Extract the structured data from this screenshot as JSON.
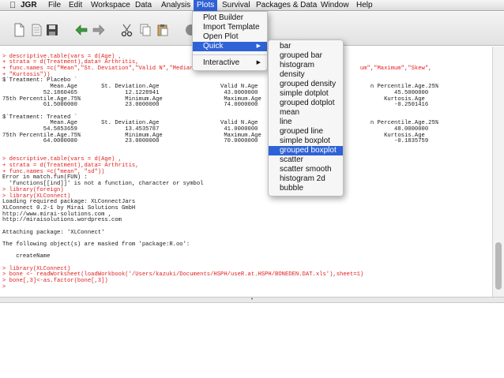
{
  "menubar": {
    "app": "JGR",
    "items": [
      "File",
      "Edit",
      "Workspace",
      "Data",
      "Analysis",
      "Plots",
      "Survival",
      "Packages & Data",
      "Window",
      "Help"
    ],
    "active": "Plots"
  },
  "plots_menu": {
    "items": [
      "Plot Builder",
      "Import Template",
      "Open Plot"
    ],
    "quick": "Quick",
    "interactive": "Interactive"
  },
  "quick_menu": {
    "items": [
      "bar",
      "grouped bar",
      "histogram",
      "density",
      "grouped density",
      "simple dotplot",
      "grouped dotplot",
      "mean",
      "line",
      "grouped line",
      "simple boxplot",
      "grouped boxplot",
      "scatter",
      "scatter smooth",
      "histogram 2d",
      "bubble"
    ],
    "highlighted": "grouped boxplot"
  },
  "console": {
    "lines": [
      {
        "t": "cmd",
        "s": ""
      },
      {
        "t": "cmd",
        "s": "> descriptive.table(vars = d(Age) ,"
      },
      {
        "t": "cmd",
        "s": "+ strata = d(Treatment),data= Arthritis,"
      },
      {
        "t": "cmd",
        "s": "+ func.names =c(\"Mean\",\"St. Deviation\",\"Valid N\",\"Median\",\"25th Percentile\",\"                            um\",\"Maximum\",\"Skew\","
      },
      {
        "t": "cmd",
        "s": "+ \"Kurtosis\"))"
      },
      {
        "t": "out",
        "s": "$`Treatment: Placebo `"
      },
      {
        "t": "out",
        "s": "              Mean.Age       St. Deviation.Age                  Valid N.Age                                 n Percentile.Age.25%"
      },
      {
        "t": "out",
        "s": "            52.1860465              12.1228941                   43.0000000                                        45.5000000"
      },
      {
        "t": "out",
        "s": "75th Percentile.Age.75%             Minimum.Age                  Maximum.Age                                    Kurtosis.Age"
      },
      {
        "t": "out",
        "s": "            61.5000000              23.0000000                   74.0000000                                        -0.2501416"
      },
      {
        "t": "out",
        "s": ""
      },
      {
        "t": "out",
        "s": "$`Treatment: Treated `"
      },
      {
        "t": "out",
        "s": "              Mean.Age       St. Deviation.Age                  Valid N.Age                                 n Percentile.Age.25%"
      },
      {
        "t": "out",
        "s": "            54.5853659              13.4535787                   41.0000000                                        48.0000000"
      },
      {
        "t": "out",
        "s": "75th Percentile.Age.75%             Minimum.Age                  Maximum.Age                                    Kurtosis.Age"
      },
      {
        "t": "out",
        "s": "            64.0000000              23.0000000                   70.0000000                                        -0.1835759"
      },
      {
        "t": "out",
        "s": ""
      },
      {
        "t": "out",
        "s": ""
      },
      {
        "t": "cmd",
        "s": "> descriptive.table(vars = d(Age) ,"
      },
      {
        "t": "cmd",
        "s": "+ strata = d(Treatment),data= Arthritis,"
      },
      {
        "t": "cmd",
        "s": "+ func.names =c(\"mean\", \"sd\"))"
      },
      {
        "t": "err",
        "s": "Error in match.fun(FUN) :"
      },
      {
        "t": "err",
        "s": "  'functions[[ind]]' is not a function, character or symbol"
      },
      {
        "t": "cmd",
        "s": "> library(foreign)"
      },
      {
        "t": "cmd",
        "s": "> library(XLConnect)"
      },
      {
        "t": "out",
        "s": "Loading required package: XLConnectJars"
      },
      {
        "t": "out",
        "s": "XLConnect 0.2-1 by Mirai Solutions GmbH"
      },
      {
        "t": "out",
        "s": "http://www.mirai-solutions.com ,"
      },
      {
        "t": "out",
        "s": "http://miraisolutions.wordpress.com"
      },
      {
        "t": "out",
        "s": ""
      },
      {
        "t": "out",
        "s": "Attaching package: 'XLConnect'"
      },
      {
        "t": "out",
        "s": ""
      },
      {
        "t": "out",
        "s": "The following object(s) are masked from 'package:R.oo':"
      },
      {
        "t": "out",
        "s": ""
      },
      {
        "t": "out",
        "s": "    createName"
      },
      {
        "t": "out",
        "s": ""
      },
      {
        "t": "cmd",
        "s": "> library(XLConnect)"
      },
      {
        "t": "cmd",
        "s": "> bone <- readWorksheet(loadWorkbook('/Users/kazuki/Documents/HSPH/useR.at.HSPH/BONEDEN.DAT.xls'),sheet=1)"
      },
      {
        "t": "cmd",
        "s": "> bone[,3]<-as.factor(bone[,3])"
      },
      {
        "t": "cmd",
        "s": ">"
      }
    ]
  },
  "icons": [
    "new-document-icon",
    "open-document-icon",
    "save-icon",
    "undo-icon",
    "redo-icon",
    "cut-icon",
    "copy-icon",
    "paste-icon",
    "stop-icon"
  ],
  "colors": {
    "highlight": "#2f62d6",
    "command_text": "#e01d1d"
  }
}
